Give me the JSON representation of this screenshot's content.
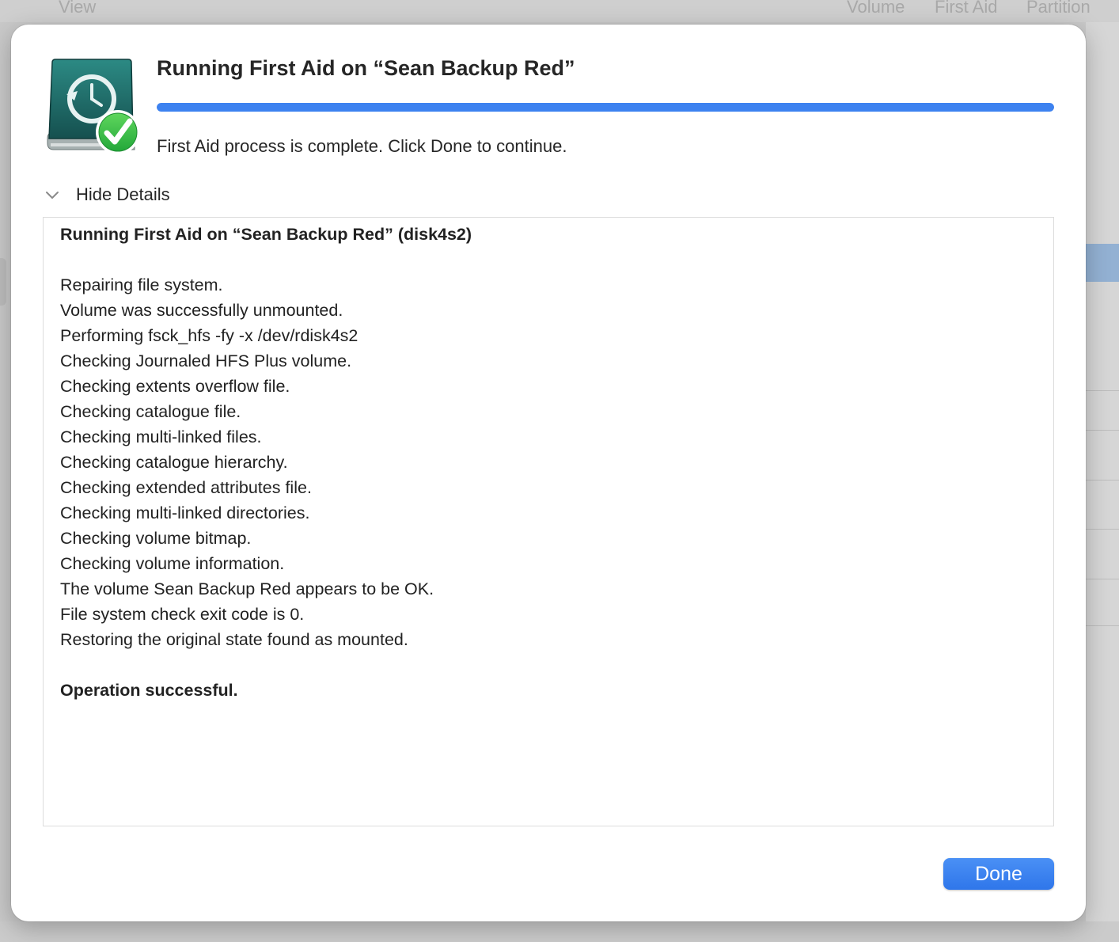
{
  "background": {
    "toolbar_left": "View",
    "toolbar_right": [
      "Volume",
      "First Aid",
      "Partition"
    ]
  },
  "dialog": {
    "icon": "time-machine-disk-checkmark-icon",
    "title": "Running First Aid on “Sean Backup Red”",
    "progress": 1.0,
    "status": "First Aid process is complete. Click Done to continue.",
    "details_toggle": "Hide Details",
    "log": [
      {
        "text": "Running First Aid on “Sean Backup Red” (disk4s2)",
        "bold": true
      },
      {
        "text": "",
        "bold": false
      },
      {
        "text": "Repairing file system.",
        "bold": false
      },
      {
        "text": "Volume was successfully unmounted.",
        "bold": false
      },
      {
        "text": "Performing fsck_hfs -fy -x /dev/rdisk4s2",
        "bold": false
      },
      {
        "text": "Checking Journaled HFS Plus volume.",
        "bold": false
      },
      {
        "text": "Checking extents overflow file.",
        "bold": false
      },
      {
        "text": "Checking catalogue file.",
        "bold": false
      },
      {
        "text": "Checking multi-linked files.",
        "bold": false
      },
      {
        "text": "Checking catalogue hierarchy.",
        "bold": false
      },
      {
        "text": "Checking extended attributes file.",
        "bold": false
      },
      {
        "text": "Checking multi-linked directories.",
        "bold": false
      },
      {
        "text": "Checking volume bitmap.",
        "bold": false
      },
      {
        "text": "Checking volume information.",
        "bold": false
      },
      {
        "text": "The volume Sean Backup Red appears to be OK.",
        "bold": false
      },
      {
        "text": "File system check exit code is 0.",
        "bold": false
      },
      {
        "text": "Restoring the original state found as mounted.",
        "bold": false
      },
      {
        "text": "",
        "bold": false
      },
      {
        "text": "Operation successful.",
        "bold": true
      }
    ],
    "done_label": "Done"
  },
  "colors": {
    "accent": "#3d82f0",
    "disk": "#1f6e6a",
    "check": "#34c759"
  }
}
